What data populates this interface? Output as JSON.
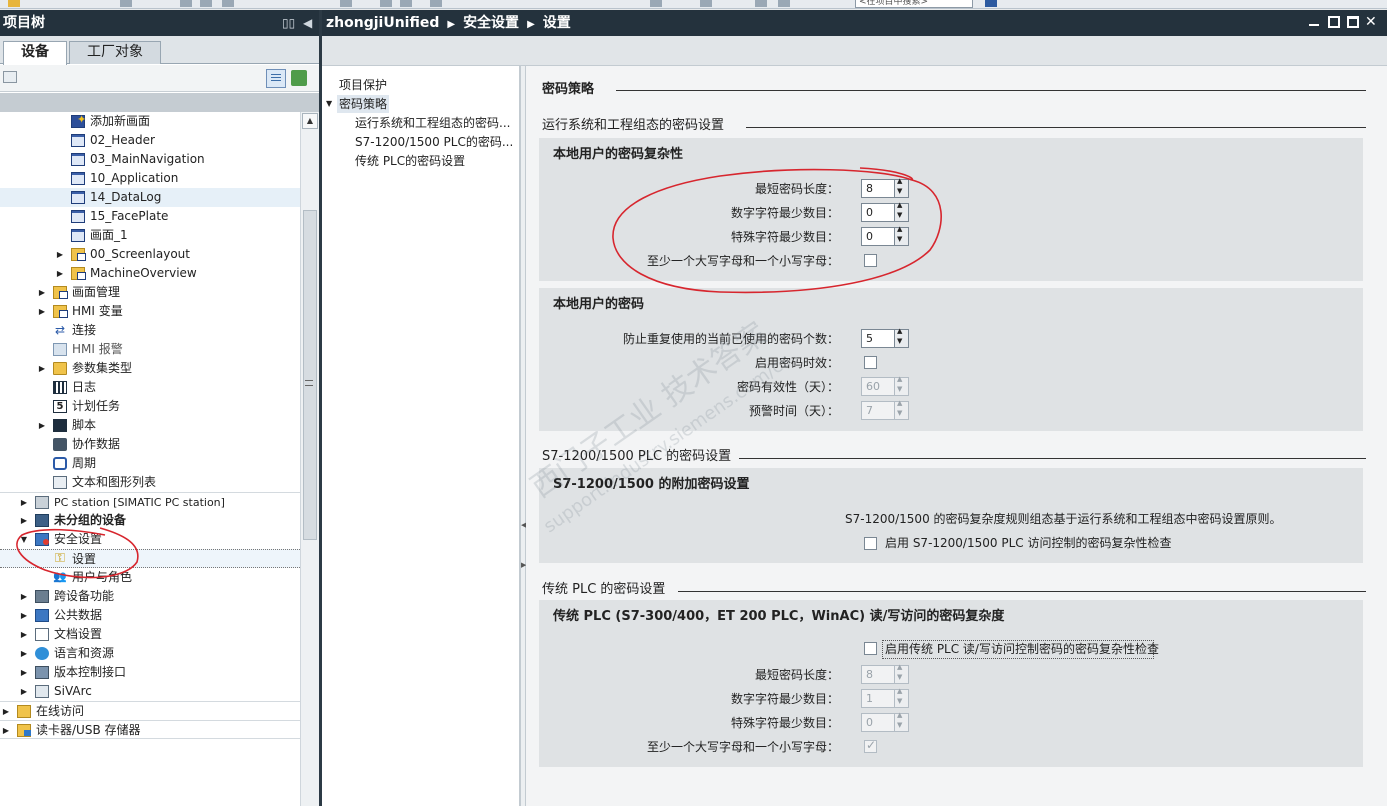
{
  "toolbar": {
    "search_placeholder": "<在项目中搜索>"
  },
  "project_tree": {
    "title": "项目树",
    "tabs": [
      "设备",
      "工厂对象"
    ],
    "items": [
      {
        "label": "添加新画面",
        "icon": "add-screen-icon"
      },
      {
        "label": "02_Header",
        "icon": "screen-icon"
      },
      {
        "label": "03_MainNavigation",
        "icon": "screen-icon"
      },
      {
        "label": "10_Application",
        "icon": "screen-icon"
      },
      {
        "label": "14_DataLog",
        "icon": "screen-icon"
      },
      {
        "label": "15_FacePlate",
        "icon": "screen-icon"
      },
      {
        "label": "画面_1",
        "icon": "screen-icon"
      },
      {
        "label": "00_Screenlayout",
        "icon": "screen-folder-icon"
      },
      {
        "label": "MachineOverview",
        "icon": "screen-folder-icon"
      },
      {
        "label": "画面管理",
        "icon": "folder-icon"
      },
      {
        "label": "HMI 变量",
        "icon": "hmi-tag-icon"
      },
      {
        "label": "连接",
        "icon": "connection-icon"
      },
      {
        "label": "HMI 报警",
        "icon": "alarm-icon"
      },
      {
        "label": "参数集类型",
        "icon": "folder-icon"
      },
      {
        "label": "日志",
        "icon": "log-icon"
      },
      {
        "label": "计划任务",
        "icon": "scheduler-icon"
      },
      {
        "label": "脚本",
        "icon": "script-icon"
      },
      {
        "label": "协作数据",
        "icon": "collab-data-icon"
      },
      {
        "label": "周期",
        "icon": "cycle-icon"
      },
      {
        "label": "文本和图形列表",
        "icon": "text-list-icon"
      },
      {
        "label": "PC station [SIMATIC PC station]",
        "icon": "pc-station-icon"
      },
      {
        "label": "未分组的设备",
        "icon": "ungrouped-devices-icon"
      },
      {
        "label": "安全设置",
        "icon": "security-settings-icon"
      },
      {
        "label": "设置",
        "icon": "key-icon"
      },
      {
        "label": "用户与角色",
        "icon": "users-icon"
      },
      {
        "label": "跨设备功能",
        "icon": "cross-device-icon"
      },
      {
        "label": "公共数据",
        "icon": "common-data-icon"
      },
      {
        "label": "文档设置",
        "icon": "doc-settings-icon"
      },
      {
        "label": "语言和资源",
        "icon": "language-icon"
      },
      {
        "label": "版本控制接口",
        "icon": "version-control-icon"
      },
      {
        "label": "SiVArc",
        "icon": "sivarc-icon"
      },
      {
        "label": "在线访问",
        "icon": "online-access-icon"
      },
      {
        "label": "读卡器/USB 存储器",
        "icon": "card-reader-icon"
      }
    ]
  },
  "editor": {
    "breadcrumb": [
      "zhongjiUnified",
      "安全设置",
      "设置"
    ],
    "nav": [
      "项目保护",
      "密码策略",
      "运行系统和工程组态的密码...",
      "S7-1200/1500 PLC的密码...",
      "传统 PLC的密码设置"
    ],
    "content": {
      "title": "密码策略",
      "sec1": "运行系统和工程组态的密码设置",
      "g1": {
        "title": "本地用户的密码复杂性",
        "min_len_label": "最短密码长度：",
        "min_len": "8",
        "min_digit_label": "数字字符最少数目：",
        "min_digit": "0",
        "min_special_label": "特殊字符最少数目：",
        "min_special": "0",
        "upper_lower_label": "至少一个大写字母和一个小写字母："
      },
      "g2": {
        "title": "本地用户的密码",
        "reuse_label": "防止重复使用的当前已使用的密码个数：",
        "reuse": "5",
        "expire_label": "启用密码时效：",
        "validity_label": "密码有效性（天）：",
        "validity": "60",
        "warn_label": "预警时间（天）：",
        "warn": "7"
      },
      "sec2": "S7-1200/1500 PLC 的密码设置",
      "g3": {
        "title": "S7-1200/1500 的附加密码设置",
        "desc": "S7-1200/1500 的密码复杂度规则组态基于运行系统和工程组态中密码设置原则。",
        "enable_label": "启用 S7-1200/1500 PLC 访问控制的密码复杂性检查"
      },
      "sec3": "传统 PLC 的密码设置",
      "g4": {
        "title": "传统 PLC (S7-300/400，ET 200 PLC，WinAC) 读/写访问的密码复杂度",
        "enable_label": "启用传统 PLC 读/写访问控制密码的密码复杂性检查",
        "min_len_label": "最短密码长度：",
        "min_len": "8",
        "min_digit_label": "数字字符最少数目：",
        "min_digit": "1",
        "min_special_label": "特殊字符最少数目：",
        "min_special": "0",
        "upper_lower_label": "至少一个大写字母和一个小写字母："
      }
    }
  },
  "watermark": {
    "line1": "西门子工业  技术答案",
    "line2": "support.industry.siemens.com/cs"
  },
  "colors": {
    "title_bar": "#24323d",
    "annotation_red": "#d7262e",
    "group_bg": "#dfe2e4"
  }
}
